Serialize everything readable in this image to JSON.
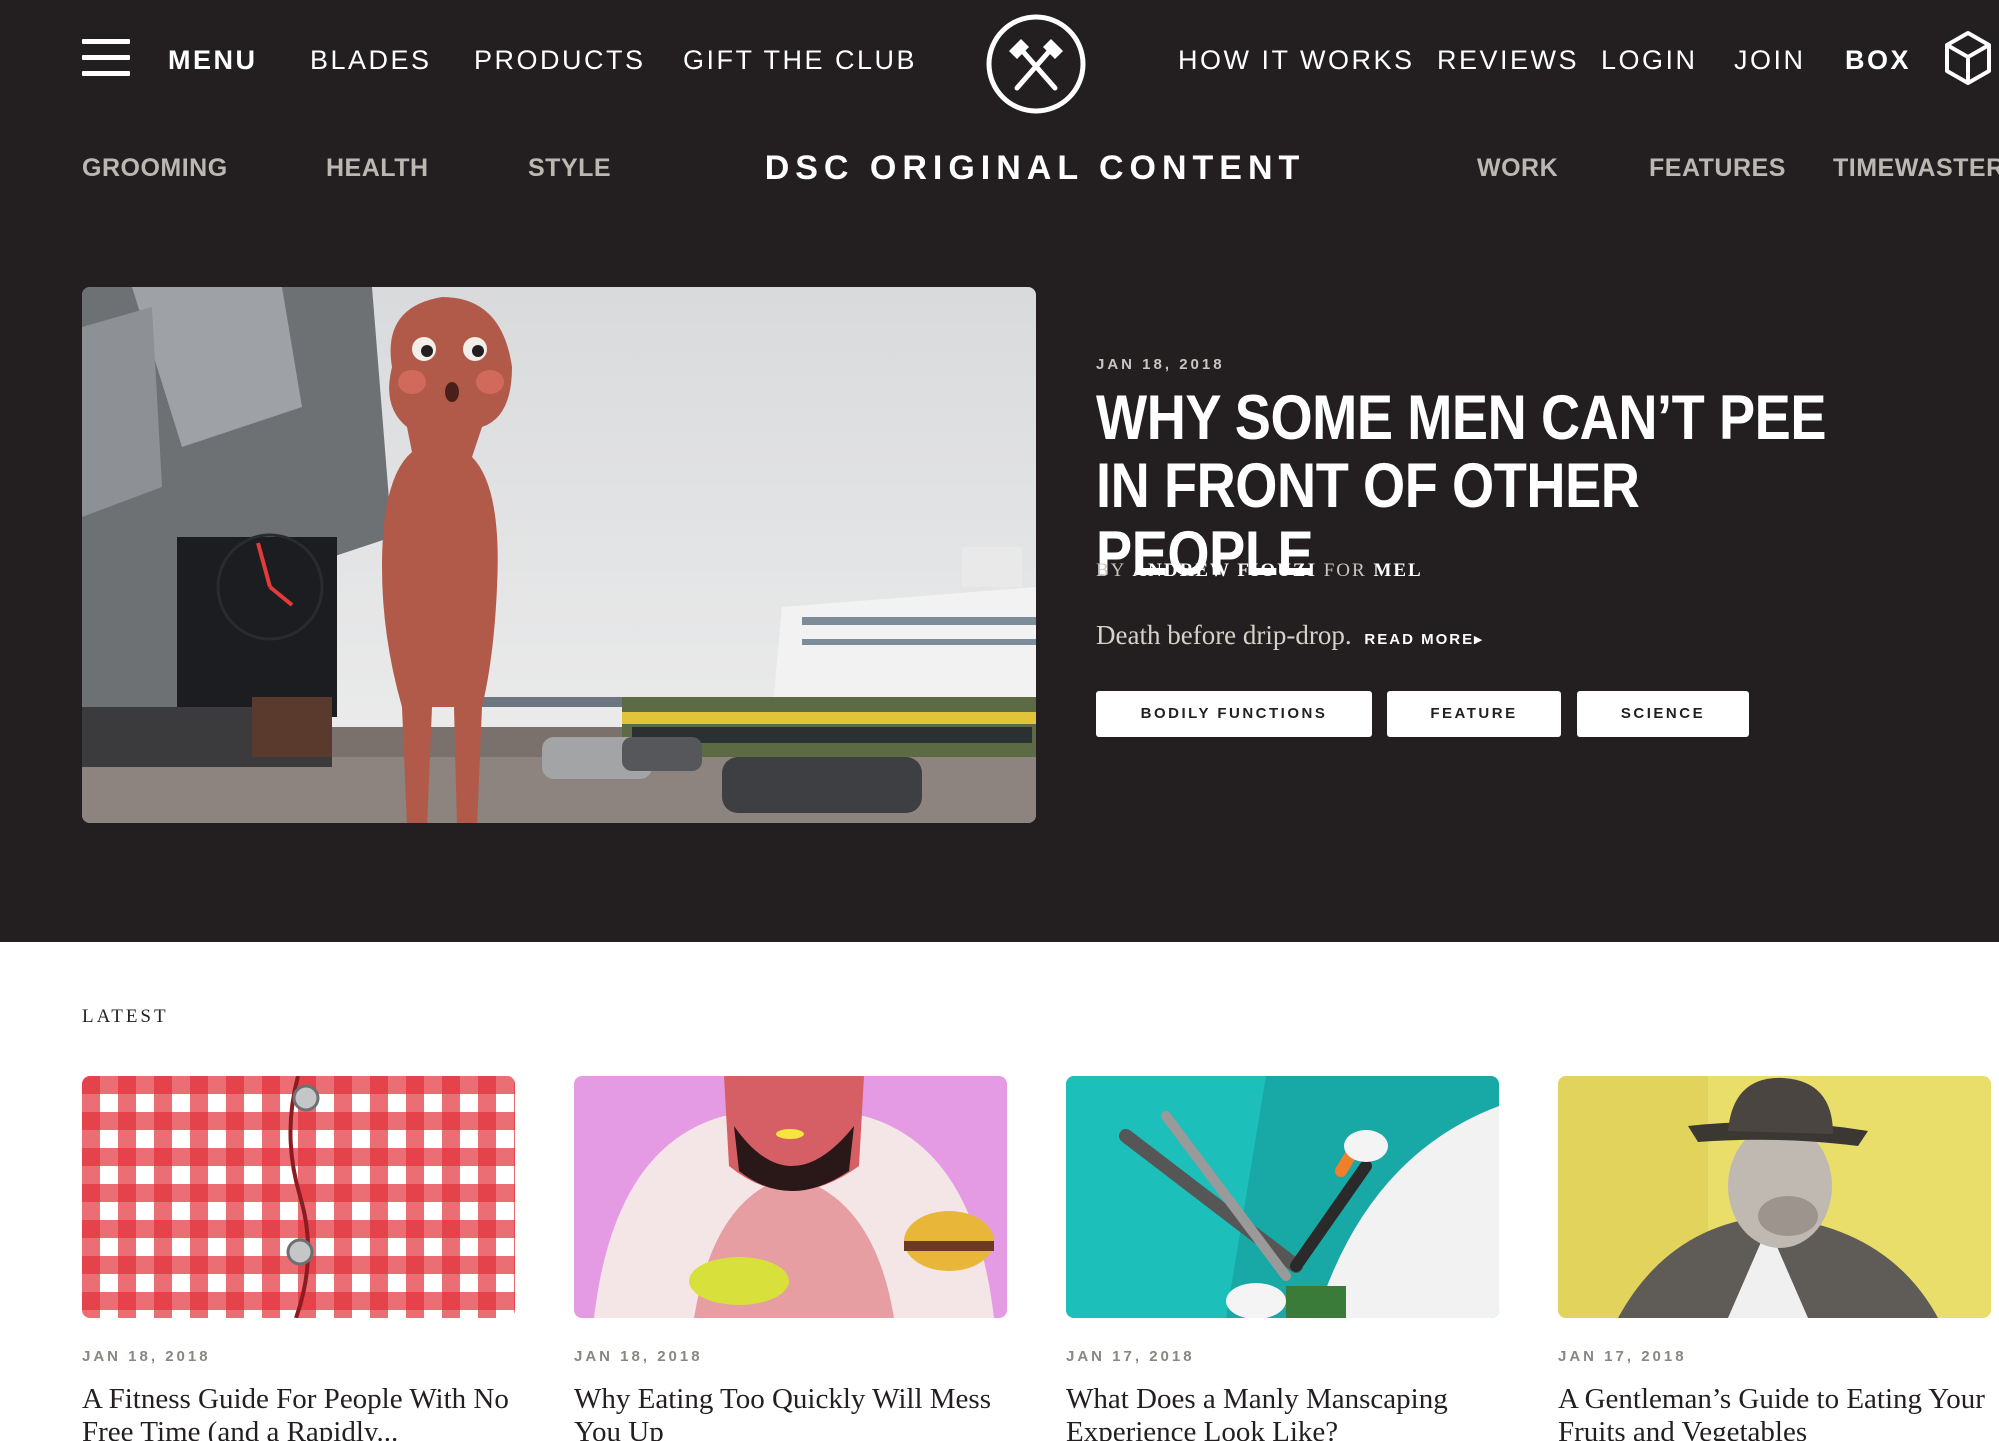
{
  "header": {
    "menu_label": "MENU",
    "left_links": [
      "BLADES",
      "PRODUCTS",
      "GIFT THE CLUB"
    ],
    "right_links": [
      "HOW IT WORKS",
      "REVIEWS",
      "LOGIN",
      "JOIN"
    ],
    "box_label": "BOX",
    "logo_icon": "crossed-hammers-icon",
    "box_icon": "cube-icon"
  },
  "subnav": {
    "title": "DSC ORIGINAL CONTENT",
    "left": [
      "GROOMING",
      "HEALTH",
      "STYLE"
    ],
    "right": [
      "WORK",
      "FEATURES",
      "TIMEWASTERS"
    ]
  },
  "hero": {
    "date": "JAN 18, 2018",
    "title": "WHY SOME MEN CAN’T PEE IN FRONT OF OTHER PEOPLE",
    "by": "BY",
    "author": "ANDREW FIOUZI",
    "for": "FOR",
    "publication": "MEL",
    "dek": "Death before drip-drop.",
    "read_more": "READ MORE▸",
    "tags": [
      "BODILY FUNCTIONS",
      "FEATURE",
      "SCIENCE"
    ]
  },
  "latest": {
    "label": "LATEST",
    "articles": [
      {
        "date": "JAN 18, 2018",
        "title": "A Fitness Guide For People With No Free Time (and a Rapidly..."
      },
      {
        "date": "JAN 18, 2018",
        "title": "Why Eating Too Quickly Will Mess You Up"
      },
      {
        "date": "JAN 17, 2018",
        "title": "What Does a Manly Manscaping Experience Look Like?"
      },
      {
        "date": "JAN 17, 2018",
        "title": "A Gentleman’s Guide to Eating Your Fruits and Vegetables"
      }
    ]
  },
  "colors": {
    "dark_background": "#231f20",
    "white": "#ffffff",
    "subnav_gray": "#bbb8b3"
  }
}
